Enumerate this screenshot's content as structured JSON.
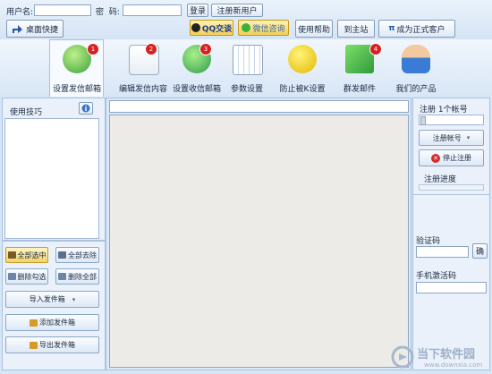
{
  "login": {
    "username_label": "用户名:",
    "password_label": "密  码:",
    "login_button": "登录",
    "register_button": "注册新用户",
    "username_value": "",
    "password_value": ""
  },
  "header_buttons": {
    "desktop_shortcut": "桌面快捷",
    "qq_chat": "QQ交谈",
    "wechat_consult": "微信咨询",
    "help": "使用帮助",
    "main_site": "到主站",
    "become_customer": "成为正式客户"
  },
  "toolbar": [
    {
      "label": "设置发信邮箱",
      "badge": "1",
      "icon": "send-mail-icon"
    },
    {
      "label": "编辑发信内容",
      "badge": "2",
      "icon": "edit-content-icon"
    },
    {
      "label": "设置收信邮箱",
      "badge": "3",
      "icon": "receive-mail-icon"
    },
    {
      "label": "参数设置",
      "badge": "",
      "icon": "calendar-icon"
    },
    {
      "label": "防止被K设置",
      "badge": "",
      "icon": "wrench-icon"
    },
    {
      "label": "群发邮件",
      "badge": "4",
      "icon": "envelope-icon"
    },
    {
      "label": "我们的产品",
      "badge": "",
      "icon": "person-icon"
    }
  ],
  "left_panel": {
    "tips_title": "使用技巧",
    "select_all": "全部选中",
    "remove_all": "全部去除",
    "delete_checked": "删除勾选",
    "delete_all": "删除全部",
    "import": "导入发件箱",
    "add": "添加发件箱",
    "export": "导出发件箱"
  },
  "right_panel": {
    "register_count": "注册 1个帐号",
    "register_account": "注册帐号",
    "stop_register": "停止注册",
    "progress_label": "注册进度",
    "progress_value": 0,
    "captcha_label": "验证码",
    "captcha_confirm": "确",
    "sms_label": "手机激活码"
  },
  "watermark": {
    "brand": "当下软件园",
    "url": "www.downxia.com"
  },
  "colors": {
    "background": "#d6e6f7",
    "accent": "#2e62b8",
    "badge": "#d91f1f",
    "stop_red": "#d62a2a"
  }
}
